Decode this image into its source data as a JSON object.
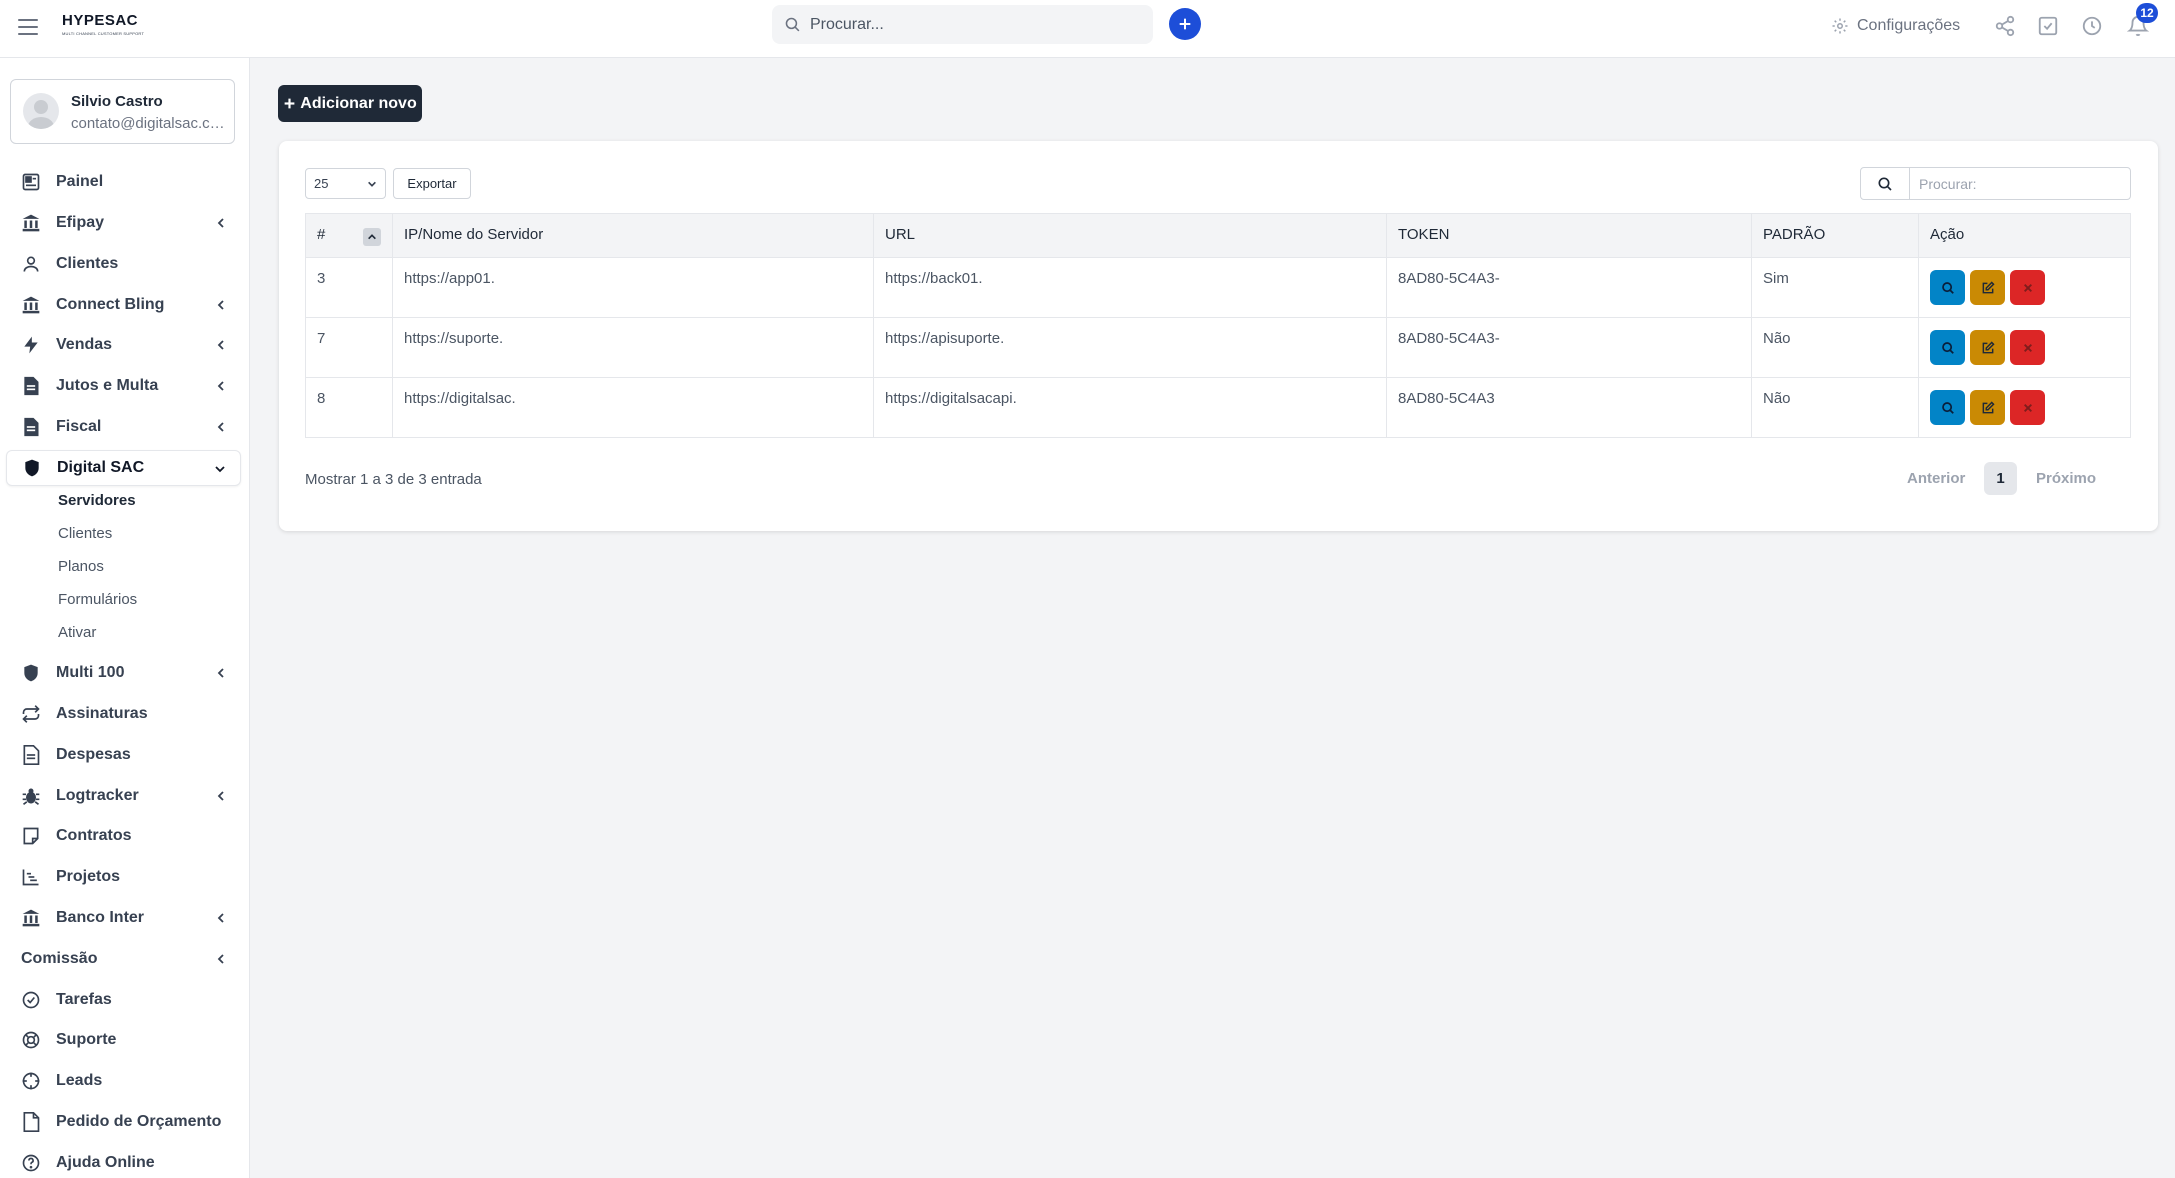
{
  "header": {
    "brand": "HYPESAC",
    "brand_tagline": "MULTI CHANNEL CUSTOMER SUPPORT",
    "search_placeholder": "Procurar...",
    "settings_label": "Configurações",
    "notification_count": "12"
  },
  "user": {
    "name": "Silvio Castro",
    "email": "contato@digitalsac.com.br"
  },
  "sidebar": {
    "items": [
      {
        "label": "Painel",
        "icon": "dashboard-icon",
        "expandable": false
      },
      {
        "label": "Efipay",
        "icon": "bank-icon",
        "expandable": true
      },
      {
        "label": "Clientes",
        "icon": "user-icon",
        "expandable": false
      },
      {
        "label": "Connect Bling",
        "icon": "bank-icon",
        "expandable": true
      },
      {
        "label": "Vendas",
        "icon": "bolt-icon",
        "expandable": true
      },
      {
        "label": "Jutos e Multa",
        "icon": "file-icon",
        "expandable": true
      },
      {
        "label": "Fiscal",
        "icon": "file-icon",
        "expandable": true
      },
      {
        "label": "Digital SAC",
        "icon": "shield-icon",
        "expandable": true,
        "open": true
      },
      {
        "label": "Multi 100",
        "icon": "shield-icon",
        "expandable": true
      },
      {
        "label": "Assinaturas",
        "icon": "repeat-icon",
        "expandable": false
      },
      {
        "label": "Despesas",
        "icon": "document-icon",
        "expandable": false
      },
      {
        "label": "Logtracker",
        "icon": "bug-icon",
        "expandable": true
      },
      {
        "label": "Contratos",
        "icon": "note-icon",
        "expandable": false
      },
      {
        "label": "Projetos",
        "icon": "chart-icon",
        "expandable": false
      },
      {
        "label": "Banco Inter",
        "icon": "bank-icon",
        "expandable": true
      },
      {
        "label": "Comissão",
        "icon": "",
        "expandable": true
      },
      {
        "label": "Tarefas",
        "icon": "check-circle-icon",
        "expandable": false
      },
      {
        "label": "Suporte",
        "icon": "lifebuoy-icon",
        "expandable": false
      },
      {
        "label": "Leads",
        "icon": "crosshair-icon",
        "expandable": false
      },
      {
        "label": "Pedido de Orçamento",
        "icon": "page-icon",
        "expandable": false
      },
      {
        "label": "Ajuda Online",
        "icon": "help-icon",
        "expandable": false
      }
    ],
    "submenu": [
      "Servidores",
      "Clientes",
      "Planos",
      "Formulários",
      "Ativar"
    ]
  },
  "main": {
    "add_button": "Adicionar novo",
    "per_page": "25",
    "export_label": "Exportar",
    "search_placeholder": "Procurar:",
    "columns": [
      "#",
      "IP/Nome do Servidor",
      "URL",
      "TOKEN",
      "PADRÃO",
      "Ação"
    ],
    "rows": [
      {
        "id": "3",
        "server": "https://app01.",
        "url": "https://back01.",
        "token": "8AD80-5C4A3-",
        "default": "Sim"
      },
      {
        "id": "7",
        "server": "https://suporte.",
        "url": "https://apisuporte.",
        "token": "8AD80-5C4A3-",
        "default": "Não"
      },
      {
        "id": "8",
        "server": "https://digitalsac.",
        "url": "https://digitalsacapi.",
        "token": "8AD80-5C4A3",
        "default": "Não"
      }
    ],
    "info": "Mostrar 1 a 3 de 3 entrada",
    "pagination": {
      "prev": "Anterior",
      "current": "1",
      "next": "Próximo"
    }
  },
  "colors": {
    "primary": "#1d4ed8",
    "dark_button": "#1f2937",
    "view": "#0284c7",
    "edit": "#ca8a04",
    "delete": "#dc2626"
  }
}
